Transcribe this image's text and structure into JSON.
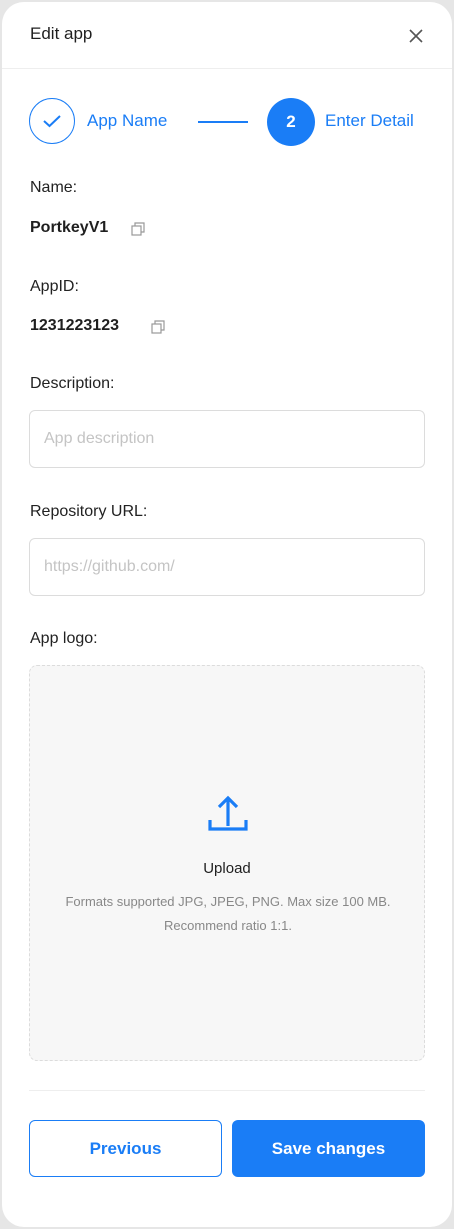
{
  "header": {
    "title": "Edit app",
    "close_icon": "close-icon"
  },
  "stepper": {
    "steps": [
      {
        "label": "App Name",
        "state": "completed",
        "icon": "check-icon"
      },
      {
        "label": "Enter Detail",
        "state": "active",
        "number": "2"
      }
    ]
  },
  "fields": {
    "name": {
      "label": "Name:",
      "value": "PortkeyV1"
    },
    "app_id": {
      "label": "AppID:",
      "value": "1231223123"
    },
    "description": {
      "label": "Description:",
      "placeholder": "App description",
      "value": ""
    },
    "repository": {
      "label": "Repository URL:",
      "placeholder": "https://github.com/",
      "value": ""
    },
    "logo": {
      "label": "App logo:",
      "upload_label": "Upload",
      "hint": "Formats supported JPG, JPEG, PNG. Max size 100 MB. Recommend ratio 1:1."
    }
  },
  "footer": {
    "previous_label": "Previous",
    "save_label": "Save changes"
  },
  "colors": {
    "accent": "#1a7df6"
  }
}
